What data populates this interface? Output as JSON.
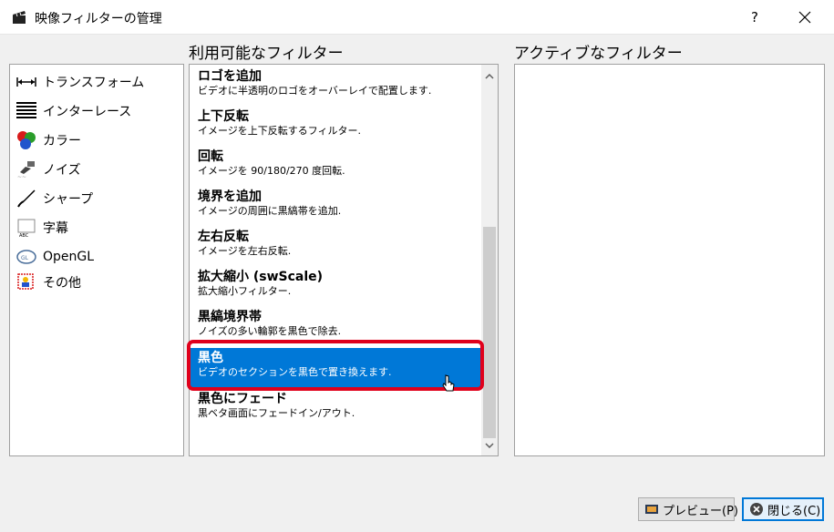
{
  "window": {
    "title": "映像フィルターの管理",
    "help_label": "?",
    "icon": "clapperboard-icon"
  },
  "headers": {
    "available": "利用可能なフィルター",
    "active": "アクティブなフィルター"
  },
  "categories": [
    {
      "label": "トランスフォーム",
      "icon": "transform-icon"
    },
    {
      "label": "インターレース",
      "icon": "interlace-icon"
    },
    {
      "label": "カラー",
      "icon": "color-icon"
    },
    {
      "label": "ノイズ",
      "icon": "noise-icon"
    },
    {
      "label": "シャープ",
      "icon": "sharpen-icon"
    },
    {
      "label": "字幕",
      "icon": "subtitle-icon"
    },
    {
      "label": "OpenGL",
      "icon": "opengl-icon"
    },
    {
      "label": "その他",
      "icon": "misc-icon"
    }
  ],
  "filters": [
    {
      "title": "ロゴを追加",
      "desc": "ビデオに半透明のロゴをオーバーレイで配置します."
    },
    {
      "title": "上下反転",
      "desc": "イメージを上下反転するフィルター."
    },
    {
      "title": "回転",
      "desc": "イメージを 90/180/270 度回転."
    },
    {
      "title": "境界を追加",
      "desc": "イメージの周囲に黒縞帯を追加."
    },
    {
      "title": "左右反転",
      "desc": "イメージを左右反転."
    },
    {
      "title": "拡大縮小 (swScale)",
      "desc": "拡大縮小フィルター."
    },
    {
      "title": "黒縞境界帯",
      "desc": "ノイズの多い輪郭を黒色で除去."
    },
    {
      "title": "黒色",
      "desc": "ビデオのセクションを黒色で置き換えます."
    },
    {
      "title": "黒色にフェード",
      "desc": "黒ベタ画面にフェードイン/アウト."
    }
  ],
  "selected_filter_index": 7,
  "buttons": {
    "preview": "プレビュー(P)",
    "close": "閉じる(C)"
  },
  "colors": {
    "selection": "#0078d7",
    "highlight": "#e0001b"
  }
}
